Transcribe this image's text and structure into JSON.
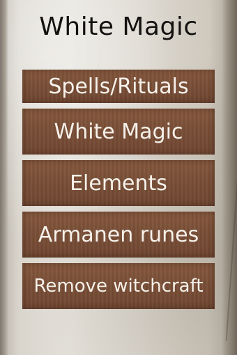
{
  "header": {
    "title": "White Magic"
  },
  "menu": {
    "items": [
      {
        "label": "Spells/Rituals"
      },
      {
        "label": "White Magic"
      },
      {
        "label": "Elements"
      },
      {
        "label": "Armanen runes"
      },
      {
        "label": "Remove witchcraft"
      }
    ]
  },
  "colors": {
    "background": "#dedad2",
    "button": "#7a4f37",
    "button_text": "#f6f1ea",
    "title_text": "#141210"
  }
}
